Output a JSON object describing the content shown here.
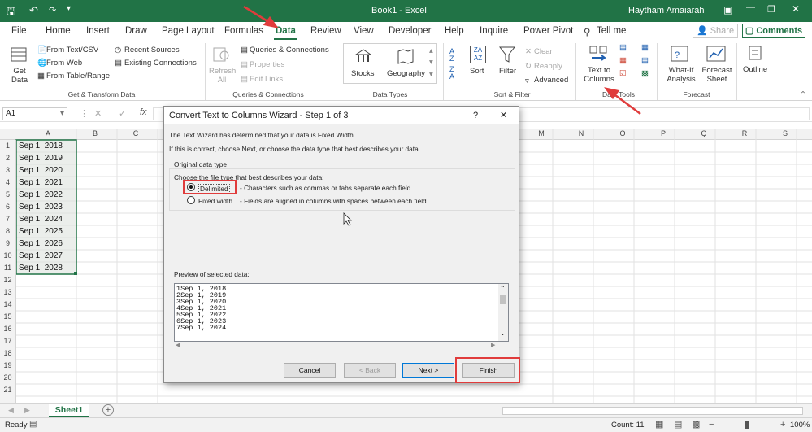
{
  "window": {
    "title": "Book1  -  Excel",
    "user": "Haytham Amaiarah"
  },
  "tabs": [
    "File",
    "Home",
    "Insert",
    "Draw",
    "Page Layout",
    "Formulas",
    "Data",
    "Review",
    "View",
    "Developer",
    "Help",
    "Inquire",
    "Power Pivot"
  ],
  "tell_me": "Tell me",
  "share_label": "Share",
  "comments_label": "Comments",
  "ribbon": {
    "get_data": "Get Data",
    "from_text": "From Text/CSV",
    "from_web": "From Web",
    "from_table": "From Table/Range",
    "recent_sources": "Recent Sources",
    "existing_connections": "Existing Connections",
    "group_get_transform": "Get & Transform Data",
    "refresh_all": "Refresh All",
    "queries_connections": "Queries & Connections",
    "properties": "Properties",
    "edit_links": "Edit Links",
    "group_queries": "Queries & Connections",
    "stocks": "Stocks",
    "geography": "Geography",
    "group_data_types": "Data Types",
    "sort": "Sort",
    "filter": "Filter",
    "clear": "Clear",
    "reapply": "Reapply",
    "advanced": "Advanced",
    "group_sort_filter": "Sort & Filter",
    "text_to_columns": "Text to Columns",
    "group_data_tools": "Data Tools",
    "what_if": "What-If Analysis",
    "forecast_sheet": "Forecast Sheet",
    "group_forecast": "Forecast",
    "outline": "Outline"
  },
  "name_box": "A1",
  "columns": [
    "A",
    "B",
    "C",
    "M",
    "N",
    "O",
    "P",
    "Q",
    "R",
    "S"
  ],
  "rows": [
    "1",
    "2",
    "3",
    "4",
    "5",
    "6",
    "7",
    "8",
    "9",
    "10",
    "11",
    "12",
    "13",
    "14",
    "15",
    "16",
    "17",
    "18",
    "19",
    "20",
    "21"
  ],
  "cells": [
    "Sep 1, 2018",
    "Sep 1, 2019",
    "Sep 1, 2020",
    "Sep 1, 2021",
    "Sep 1, 2022",
    "Sep 1, 2023",
    "Sep 1, 2024",
    "Sep 1, 2025",
    "Sep 1, 2026",
    "Sep 1, 2027",
    "Sep 1, 2028"
  ],
  "sheet_tab": "Sheet1",
  "status": {
    "ready": "Ready",
    "count": "Count: 11",
    "zoom": "100%"
  },
  "dialog": {
    "title": "Convert Text to Columns Wizard - Step 1 of 3",
    "line1": "The Text Wizard has determined that your data is Fixed Width.",
    "line2": "If this is correct, choose Next, or choose the data type that best describes your data.",
    "group_label": "Original data type",
    "choose_label": "Choose the file type that best describes your data:",
    "delimited": "Delimited",
    "delimited_desc": "- Characters such as commas or tabs separate each field.",
    "fixed_width": "Fixed width",
    "fixed_desc": "- Fields are aligned in columns with spaces between each field.",
    "preview_label": "Preview of selected data:",
    "preview_lines": [
      "1Sep 1, 2018",
      "2Sep 1, 2019",
      "3Sep 1, 2020",
      "4Sep 1, 2021",
      "5Sep 1, 2022",
      "6Sep 1, 2023",
      "7Sep 1, 2024"
    ],
    "cancel": "Cancel",
    "back": "< Back",
    "next": "Next >",
    "finish": "Finish",
    "help": "?",
    "close": "✕"
  },
  "colors": {
    "excel_green": "#217346",
    "annotation_red": "#e03c3c"
  }
}
